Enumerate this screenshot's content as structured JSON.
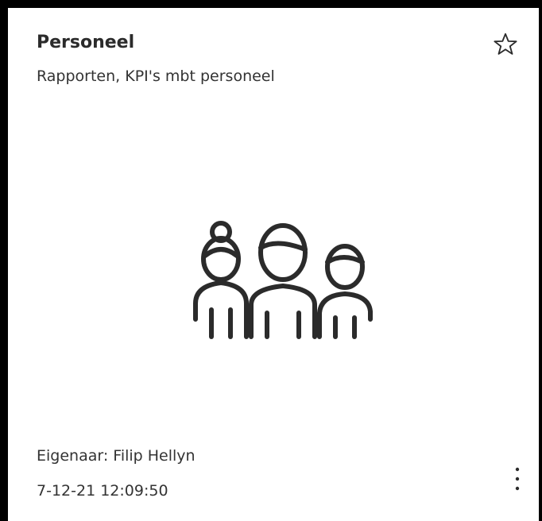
{
  "card": {
    "title": "Personeel",
    "description": "Rapporten, KPI's mbt personeel",
    "owner_text": "Eigenaar: Filip Hellyn",
    "modified": "7-12-21 12:09:50",
    "favorite_icon": "star-outline-icon",
    "hero_icon": "people-group-icon",
    "more_icon": "more-vertical-icon"
  },
  "colors": {
    "background": "#000000",
    "card": "#ffffff",
    "text": "#333333",
    "icon": "#2b2b2b"
  }
}
